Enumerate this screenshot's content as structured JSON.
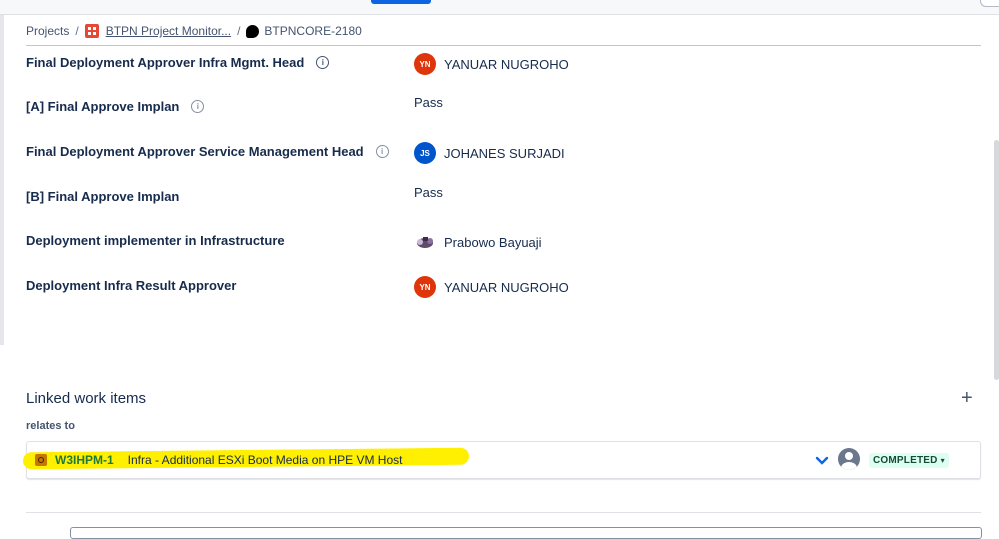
{
  "breadcrumb": {
    "root": "Projects",
    "project": "BTPN Project Monitor...",
    "issue": "BTPNCORE-2180",
    "separator": "/"
  },
  "fields": [
    {
      "label": "Final Deployment Approver Infra Mgmt. Head",
      "value": "YANUAR NUGROHO",
      "avatar_initials": "YN",
      "avatar_color": "#de350b"
    },
    {
      "label": "[A] Final Approve Implan",
      "value": "Pass"
    },
    {
      "label": "Final Deployment Approver Service Management Head",
      "value": "JOHANES SURJADI",
      "avatar_initials": "JS",
      "avatar_color": "#0055cc"
    },
    {
      "label": "[B] Final Approve Implan",
      "value": "Pass"
    },
    {
      "label": "Deployment implementer in Infrastructure",
      "value": "Prabowo Bayuaji",
      "avatar_type": "photo"
    },
    {
      "label": "Deployment Infra Result Approver",
      "value": "YANUAR NUGROHO",
      "avatar_initials": "YN",
      "avatar_color": "#de350b"
    }
  ],
  "linked": {
    "title": "Linked work items",
    "add_icon": "plus-icon",
    "relation": "relates to",
    "items": [
      {
        "key": "W3IHPM-1",
        "summary": "Infra - Additional ESXi Boot Media on HPE VM Host",
        "status": "COMPLETED",
        "status_bg": "#dcfff1",
        "highlight_color": "#ffef00"
      }
    ]
  },
  "icons": {
    "info": "info-icon",
    "priority": "chevron-down-icon",
    "assignee": "user-avatar-icon",
    "status_caret": "▾"
  }
}
